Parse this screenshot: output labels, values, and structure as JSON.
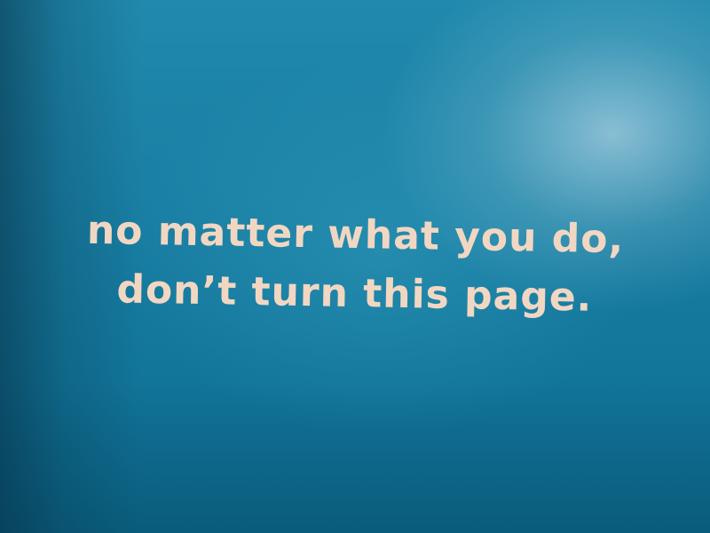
{
  "message": {
    "line1": "no matter what you do,",
    "line2": "don’t turn this page."
  },
  "colors": {
    "background": "#1a7fa4",
    "text": "#f1d7c2"
  }
}
